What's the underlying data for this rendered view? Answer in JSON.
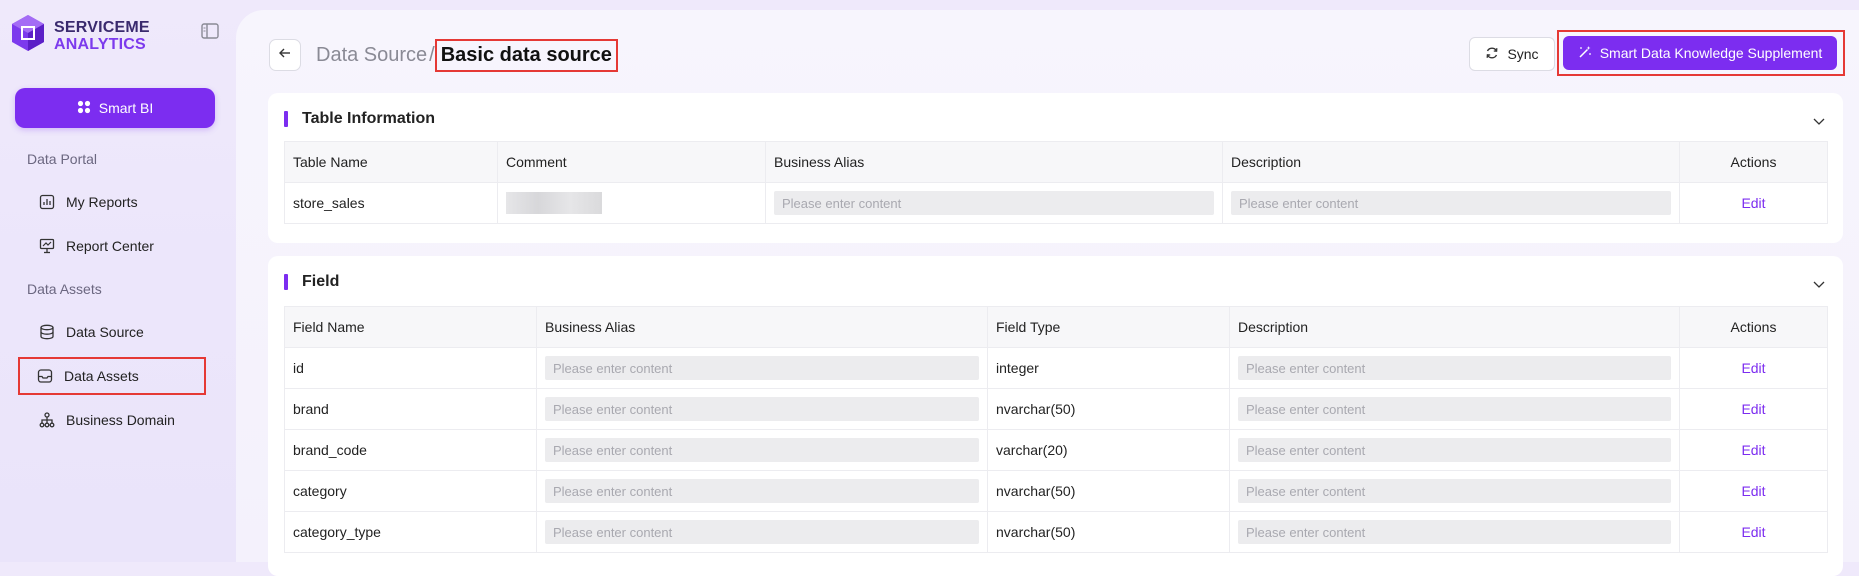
{
  "app": {
    "logo_line1": "SERVICEME",
    "logo_line2": "ANALYTICS"
  },
  "sidebar": {
    "smart_bi_label": "Smart BI",
    "sections": [
      {
        "label": "Data Portal"
      },
      {
        "label": "Data Assets"
      }
    ],
    "items": [
      {
        "label": "My Reports",
        "icon": "bar-chart-icon"
      },
      {
        "label": "Report Center",
        "icon": "presentation-icon"
      },
      {
        "label": "Data Source",
        "icon": "database-icon"
      },
      {
        "label": "Data Assets",
        "icon": "inbox-icon",
        "selected": true
      },
      {
        "label": "Business Domain",
        "icon": "sitemap-icon"
      }
    ]
  },
  "header": {
    "breadcrumb_parent": "Data Source",
    "breadcrumb_sep": "/",
    "breadcrumb_current": "Basic data source",
    "sync_label": "Sync",
    "smart_label": "Smart Data Knowledge Supplement"
  },
  "table_info": {
    "title": "Table Information",
    "columns": [
      "Table Name",
      "Comment",
      "Business Alias",
      "Description",
      "Actions"
    ],
    "rows": [
      {
        "name": "store_sales",
        "alias_placeholder": "Please enter content",
        "desc_placeholder": "Please enter content",
        "action": "Edit"
      }
    ]
  },
  "field": {
    "title": "Field",
    "columns": [
      "Field Name",
      "Business Alias",
      "Field Type",
      "Description",
      "Actions"
    ],
    "placeholder": "Please enter content",
    "action": "Edit",
    "rows": [
      {
        "name": "id",
        "type": "integer"
      },
      {
        "name": "brand",
        "type": "nvarchar(50)"
      },
      {
        "name": "brand_code",
        "type": "varchar(20)"
      },
      {
        "name": "category",
        "type": "nvarchar(50)"
      },
      {
        "name": "category_type",
        "type": "nvarchar(50)"
      }
    ]
  },
  "colors": {
    "accent": "#7c2df0",
    "highlight": "#e53935"
  }
}
